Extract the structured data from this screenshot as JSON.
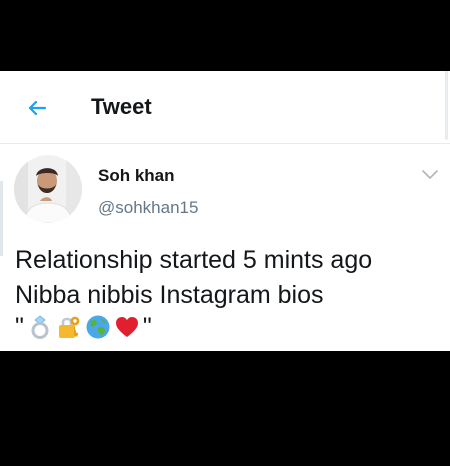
{
  "header": {
    "title": "Tweet"
  },
  "author": {
    "name": "Soh khan",
    "handle": "@sohkhan15"
  },
  "tweet": {
    "line1": "Relationship started 5 mints ago",
    "line2": "Nibba nibbis Instagram bios",
    "quote_open": "\"",
    "quote_close": "\"",
    "emojis": [
      "ring",
      "locked-with-key",
      "globe",
      "red-heart"
    ]
  },
  "colors": {
    "accent": "#1da1f2",
    "text": "#14171a",
    "secondary": "#657786"
  }
}
